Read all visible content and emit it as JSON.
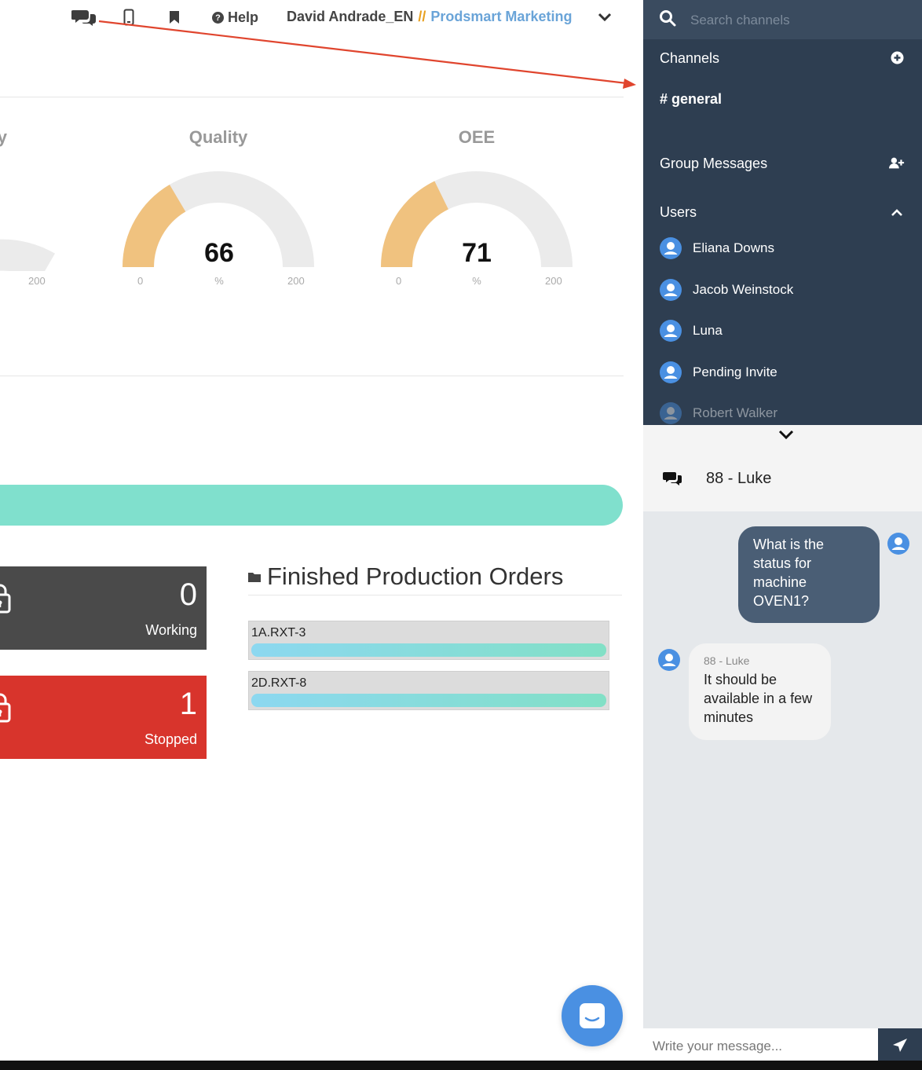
{
  "header": {
    "help_label": "Help",
    "user_name": "David Andrade_EN",
    "separator": "//",
    "company": "Prodsmart Marketing",
    "icons": [
      "chat-icon",
      "mobile-icon",
      "bookmark-icon",
      "help-icon",
      "chevron-down-icon"
    ]
  },
  "gauges": [
    {
      "title": "y",
      "value": "",
      "min": "",
      "max": "200",
      "unit": ""
    },
    {
      "title": "Quality",
      "value": "66",
      "min": "0",
      "max": "200",
      "unit": "%",
      "fraction": 0.33
    },
    {
      "title": "OEE",
      "value": "71",
      "min": "0",
      "max": "200",
      "unit": "%",
      "fraction": 0.355
    }
  ],
  "status_tiles": [
    {
      "count": "0",
      "label": "Working",
      "color": "#4a4a4a"
    },
    {
      "count": "1",
      "label": "Stopped",
      "color": "#d8342c"
    }
  ],
  "finished_orders": {
    "title": "Finished Production Orders",
    "orders": [
      {
        "code": "1A.RXT-3",
        "progress": 1.0
      },
      {
        "code": "2D.RXT-8",
        "progress": 1.0
      }
    ]
  },
  "sidebar": {
    "search_placeholder": "Search channels",
    "channels_label": "Channels",
    "channel": "# general",
    "group_messages_label": "Group Messages",
    "users_label": "Users",
    "users": [
      "Eliana Downs",
      "Jacob Weinstock",
      "Luna",
      "Pending Invite",
      "Robert Walker"
    ]
  },
  "chat": {
    "title": "88 - Luke",
    "messages": [
      {
        "direction": "out",
        "text": "What is the status for machine OVEN1?"
      },
      {
        "direction": "in",
        "author": "88 - Luke",
        "text": "It should be available in a few minutes"
      }
    ],
    "input_placeholder": "Write your message..."
  },
  "colors": {
    "gauge_fill": "#f0c27f",
    "gauge_track": "#ebebeb",
    "sidebar_bg": "#2e3e51",
    "accent_blue": "#4a90e2",
    "progress_teal": "#80e0cd",
    "annotation_arrow": "#e0452e"
  }
}
